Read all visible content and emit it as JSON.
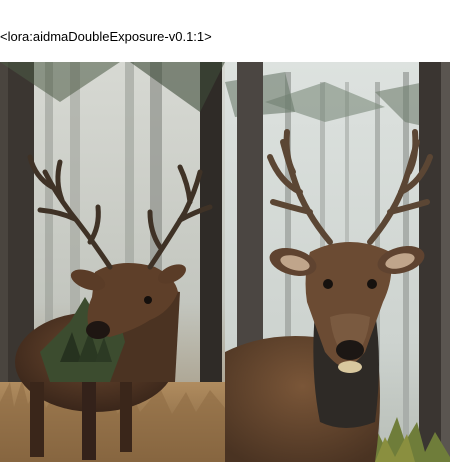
{
  "prompt": {
    "text": "<lora:aidmaDoubleExposure-v0.1:1>"
  },
  "images": [
    {
      "subject": "double exposure deer with forest",
      "palette": {
        "fog": "#c9cbc4",
        "trunk": "#3a3530",
        "fur": "#5a3a26",
        "moss": "#3f5130",
        "grass": "#a8835a"
      }
    },
    {
      "subject": "deer portrait in pine forest",
      "palette": {
        "fog": "#d6dbd8",
        "trunk": "#4b4642",
        "fur": "#6b4a33",
        "antler": "#5b4634",
        "fern": "#6f7d3a"
      }
    }
  ]
}
